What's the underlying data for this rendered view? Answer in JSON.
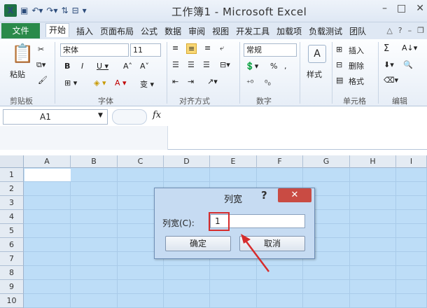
{
  "window": {
    "title": "工作簿1 - Microsoft Excel"
  },
  "tabs": {
    "file": "文件",
    "items": [
      "开始",
      "插入",
      "页面布局",
      "公式",
      "数据",
      "审阅",
      "视图",
      "开发工具",
      "加载项",
      "负载测试",
      "团队"
    ],
    "active": 0
  },
  "ribbon": {
    "clipboard": {
      "paste": "粘贴",
      "label": "剪贴板"
    },
    "font": {
      "name": "宋体",
      "size": "11",
      "label": "字体"
    },
    "alignment": {
      "label": "对齐方式"
    },
    "number": {
      "format": "常规",
      "label": "数字",
      "pct": "%",
      "comma": ","
    },
    "styles": {
      "label": "样式"
    },
    "cells": {
      "insert": "插入",
      "delete": "删除",
      "format": "格式",
      "label": "单元格"
    },
    "editing": {
      "label": "编辑",
      "sum": "Σ"
    }
  },
  "formula_bar": {
    "name_box": "A1",
    "fx": "fx"
  },
  "sheet": {
    "columns": [
      "A",
      "B",
      "C",
      "D",
      "E",
      "F",
      "G",
      "H",
      "I"
    ],
    "rows": [
      "1",
      "2",
      "3",
      "4",
      "5",
      "6",
      "7",
      "8",
      "9",
      "10"
    ]
  },
  "dialog": {
    "title": "列宽",
    "help": "?",
    "close": "✕",
    "label": "列宽(C):",
    "value": "1",
    "ok": "确定",
    "cancel": "取消"
  },
  "colors": {
    "selection": "#bdddf7",
    "file_tab": "#2a8a4a",
    "close": "#c94b43",
    "highlight": "#d62c2c"
  }
}
